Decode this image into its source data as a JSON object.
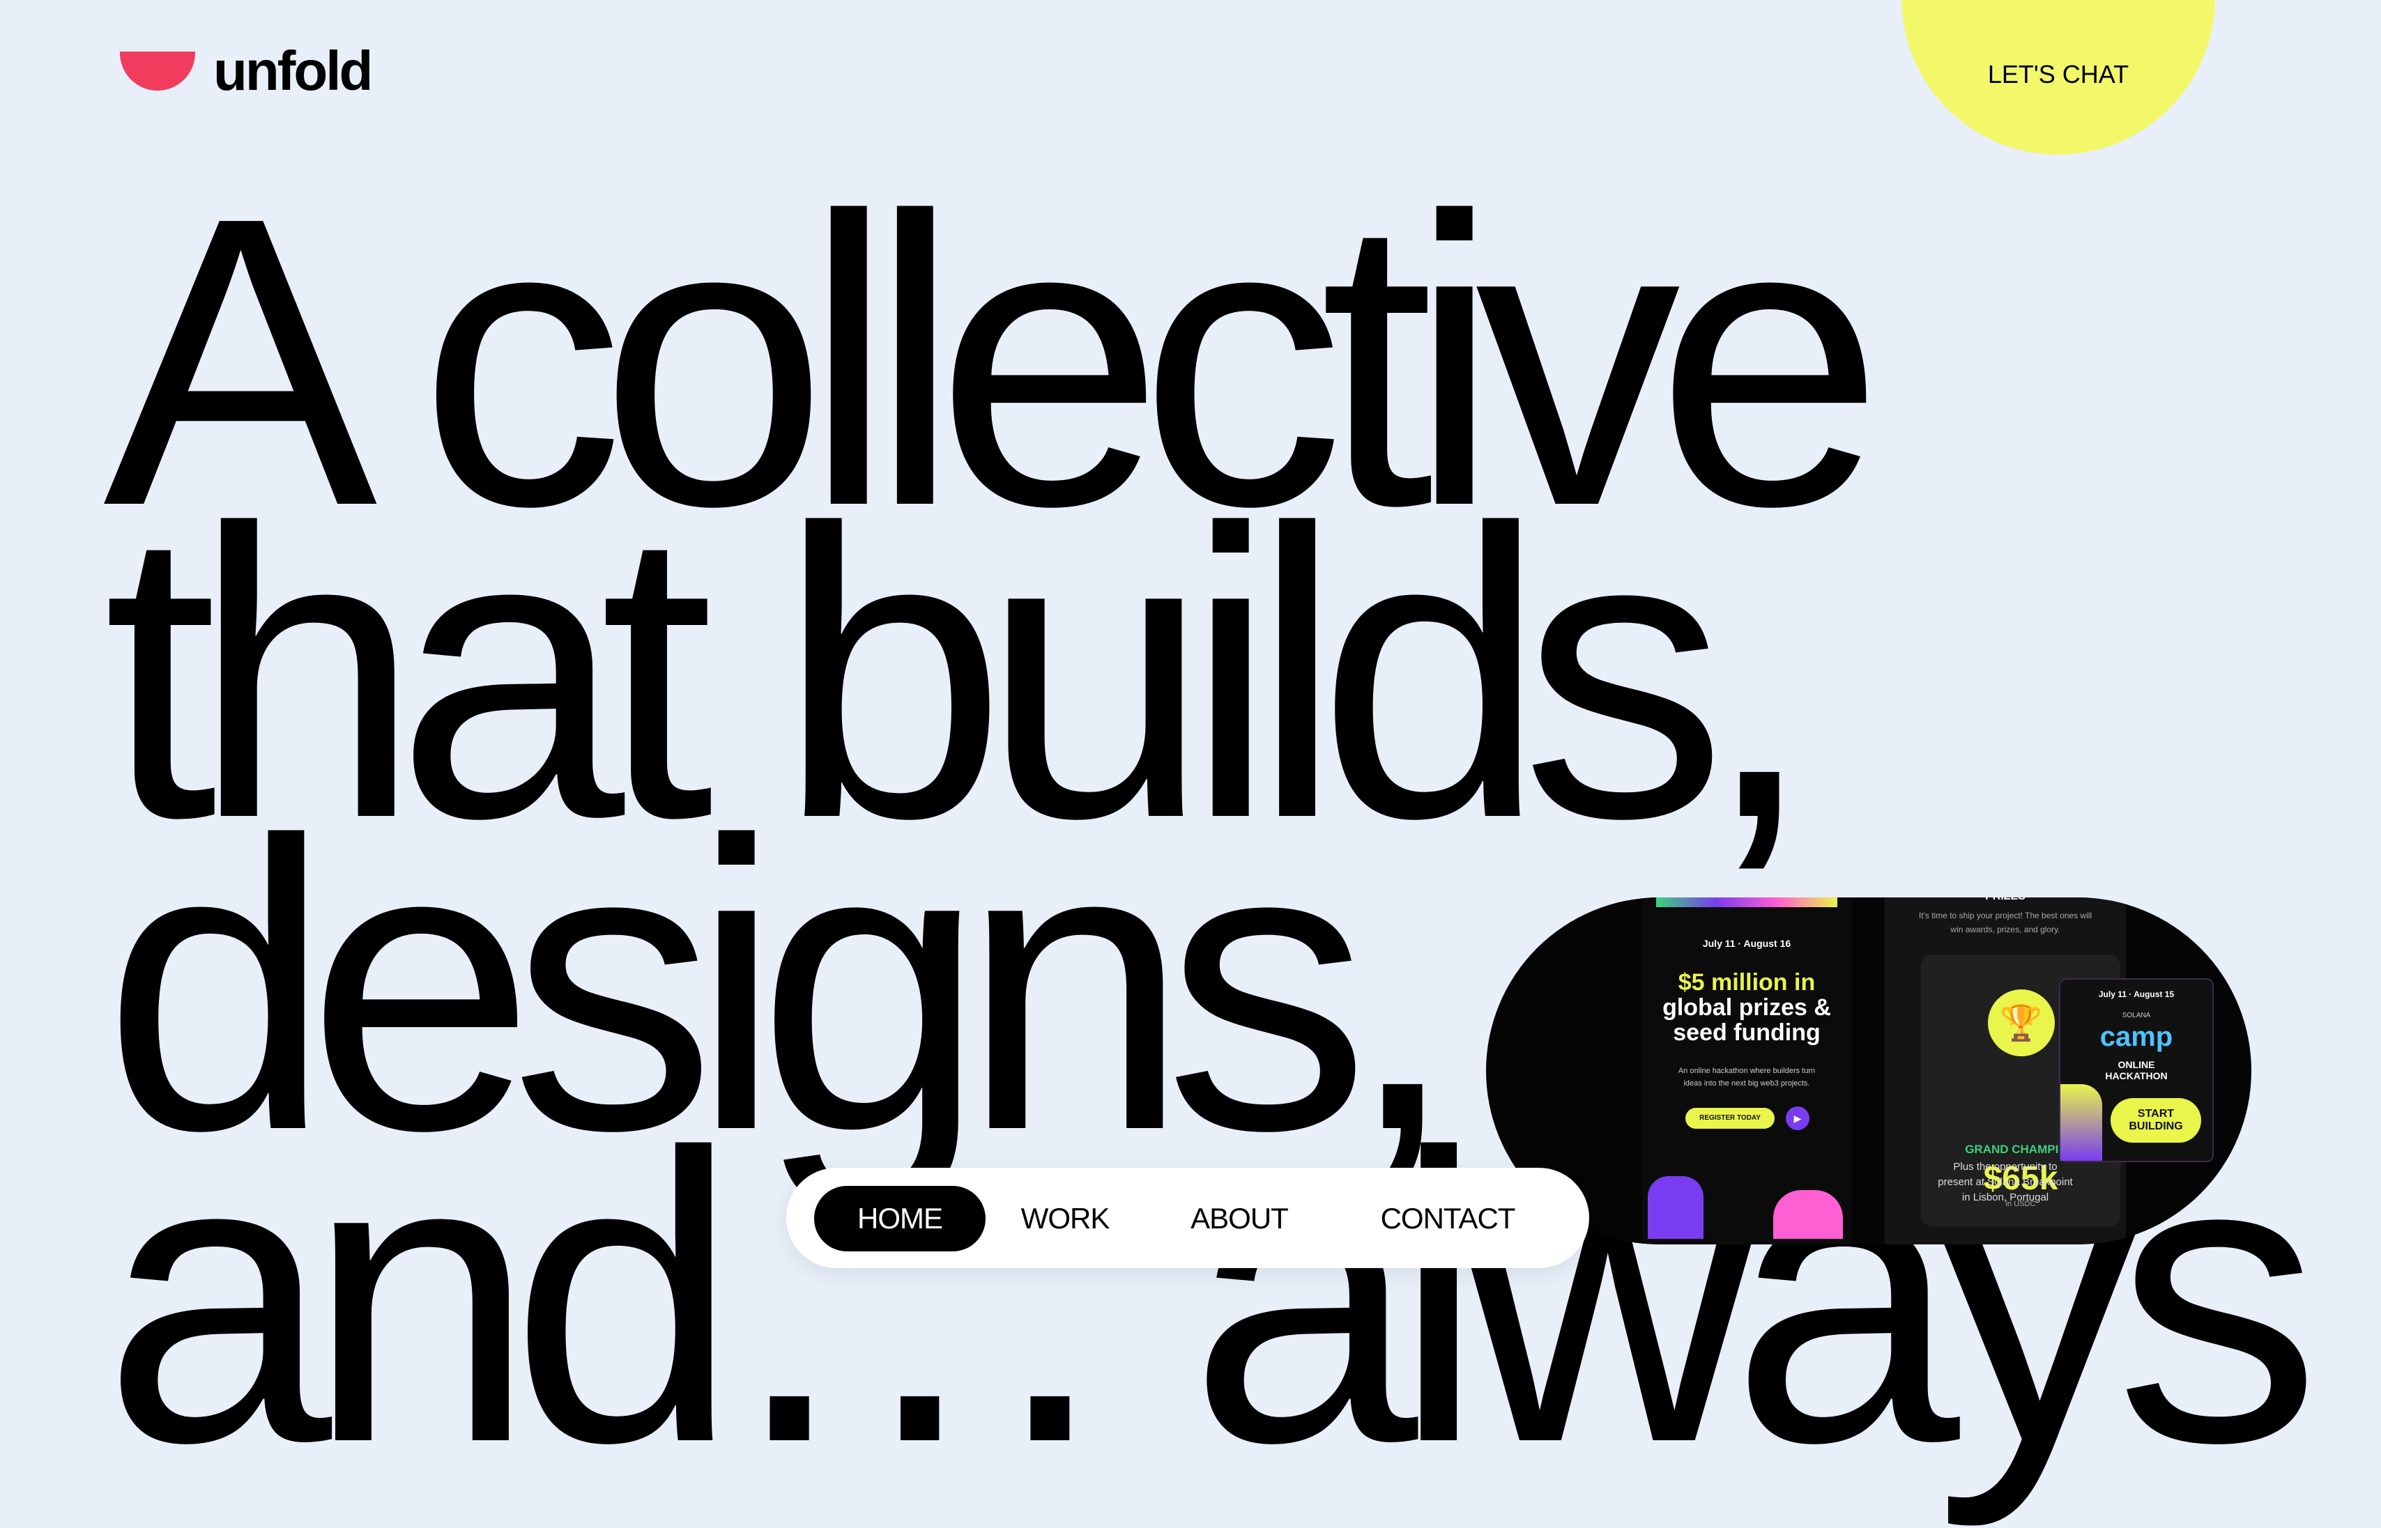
{
  "brand": {
    "name": "unfold",
    "logo_color": "#f03d5e"
  },
  "header": {
    "cta_label": "LET'S CHAT",
    "cta_color": "#f3f86a"
  },
  "hero": {
    "lines": [
      "A collective",
      "that builds,",
      "designs,",
      "and… always"
    ]
  },
  "promo": {
    "hackathon": {
      "dates": "July 11 · August 16",
      "headline": [
        "$5 million in",
        "global prizes &",
        "seed funding"
      ],
      "description": "An online hackathon where builders turn ideas into the next big web3 projects.",
      "register_label": "REGISTER TODAY"
    },
    "prizes": {
      "heading": "PRIZES",
      "intro": "It's time to ship your project! The best ones will win awards, prizes, and glory.",
      "award_label": "GRAND CHAMPION",
      "award_amount": "$65k",
      "award_currency": "in USDC",
      "note": [
        "Plus the opportunity to",
        "present at Solana Breakpoint",
        "in Lisbon, Portugal"
      ]
    },
    "camp": {
      "dates": "July 11 · August 15",
      "org": "SOLANA",
      "title": "camp",
      "subtitle": [
        "ONLINE",
        "HACKATHON"
      ],
      "cta": [
        "START",
        "BUILDING"
      ]
    },
    "colors": {
      "highlight": "#e9f54a",
      "purple": "#7a3cf0",
      "green": "#3bd17b",
      "pink": "#ff5fd2",
      "blue": "#4dc3ff"
    }
  },
  "nav": {
    "items": [
      {
        "label": "HOME",
        "active": true
      },
      {
        "label": "WORK",
        "active": false
      },
      {
        "label": "ABOUT",
        "active": false
      },
      {
        "label": "CONTACT",
        "active": false
      }
    ]
  }
}
